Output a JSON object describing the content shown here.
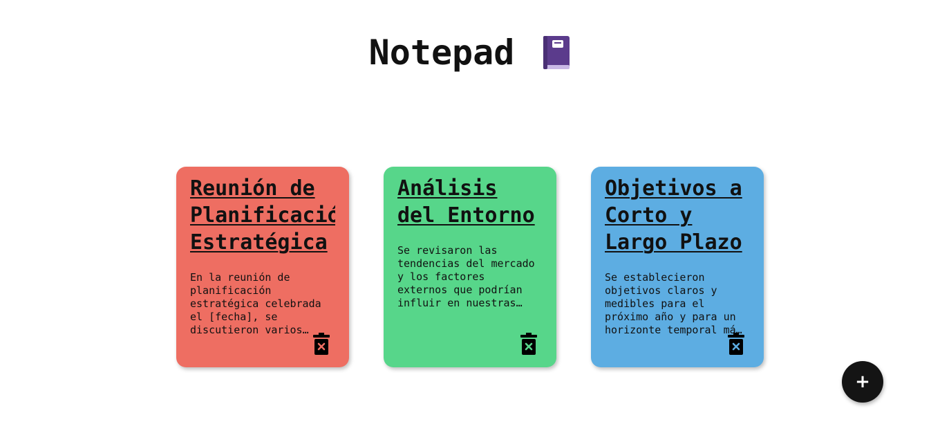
{
  "header": {
    "title": "Notepad",
    "icon": "notebook-icon"
  },
  "notes": [
    {
      "title": "Reunión de Planificación Estratégica",
      "body": "En la reunión de planificación estratégica celebrada el [fecha], se discutieron varios aspectos clave para el futuro de la organización.",
      "color": "#ee6e62",
      "delete_icon": "trash-icon"
    },
    {
      "title": "Análisis del Entorno",
      "body": "Se revisaron las tendencias del mercado y los factores externos que podrían influir en nuestras operaciones.",
      "color": "#57d68a",
      "delete_icon": "trash-icon"
    },
    {
      "title": "Objetivos a Corto y Largo Plazo",
      "body": "Se establecieron objetivos claros y medibles para el próximo año y para un horizonte temporal más amplio.",
      "color": "#5dade2",
      "delete_icon": "trash-icon"
    }
  ],
  "add_button": {
    "label": "+",
    "icon": "plus-icon"
  }
}
